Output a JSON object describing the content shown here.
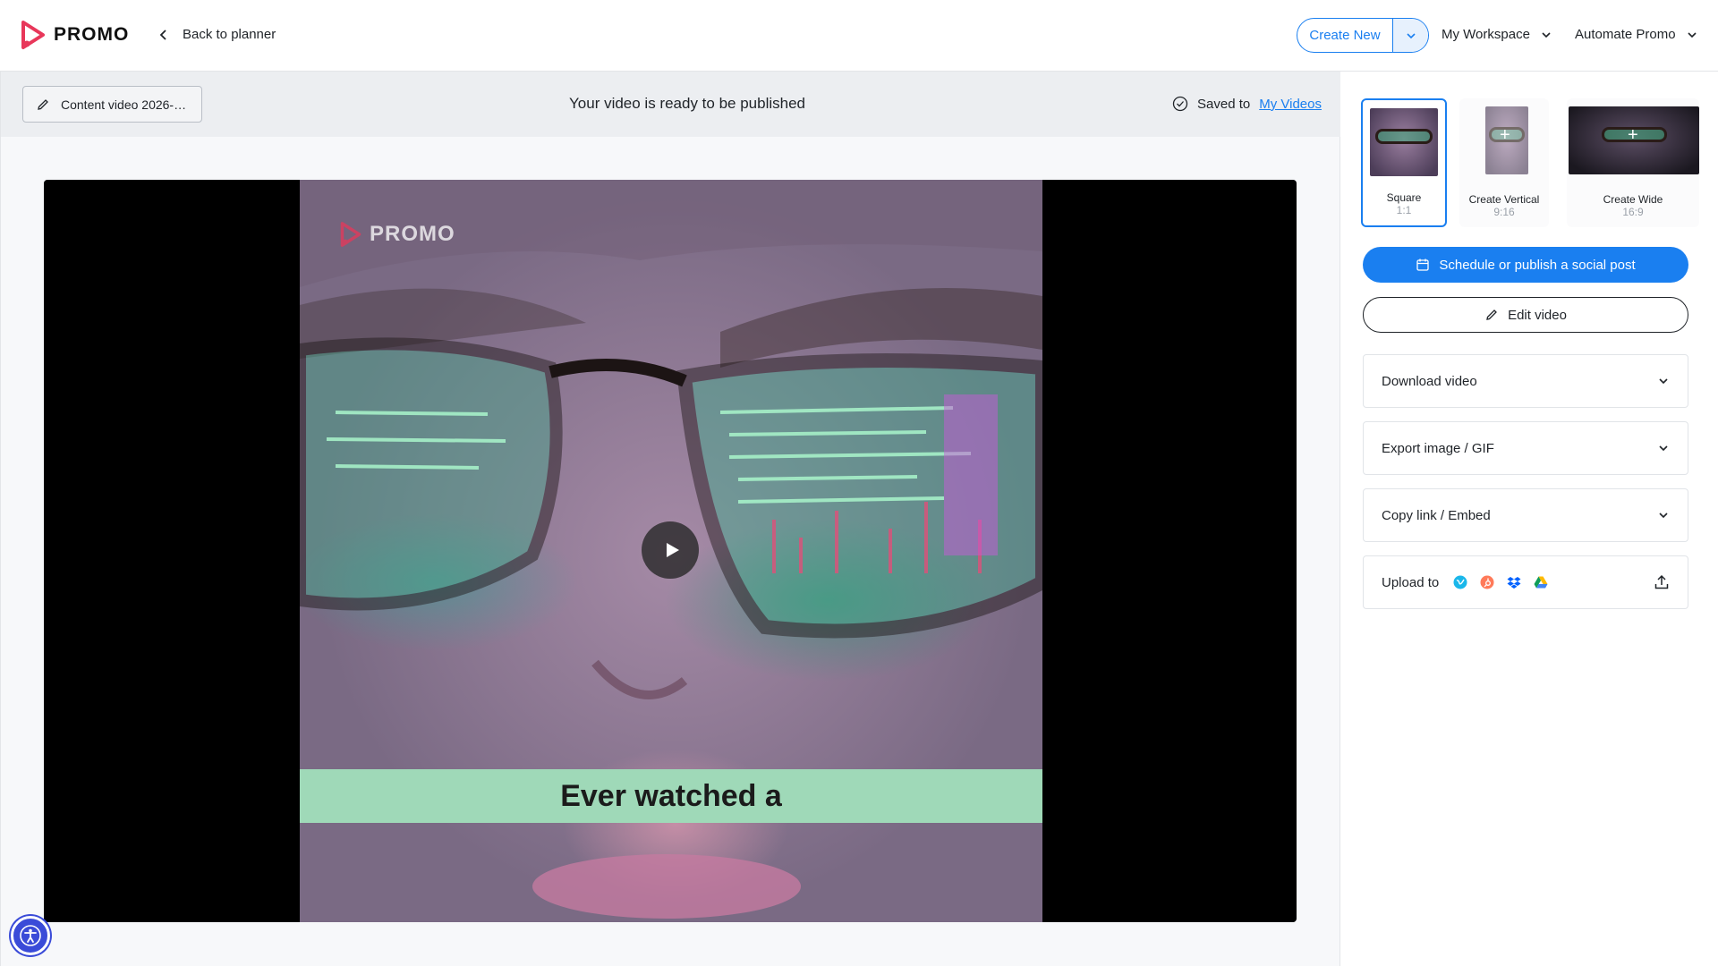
{
  "header": {
    "logo_text": "PROMO",
    "back_label": "Back to planner",
    "create_new_label": "Create New",
    "workspace_label": "My Workspace",
    "automate_label": "Automate Promo"
  },
  "infobar": {
    "video_title": "Content video 2026-…",
    "ready_text": "Your video is ready to be published",
    "saved_prefix": "Saved to",
    "saved_link": "My Videos"
  },
  "player": {
    "watermark": "PROMO",
    "caption": "Ever watched a"
  },
  "formats": [
    {
      "name": "Square",
      "ratio": "1:1",
      "selected": true
    },
    {
      "name": "Create Vertical",
      "ratio": "9:16",
      "selected": false
    },
    {
      "name": "Create Wide",
      "ratio": "16:9",
      "selected": false
    }
  ],
  "actions": {
    "schedule_label": "Schedule or publish a social post",
    "edit_label": "Edit video"
  },
  "accordions": {
    "download": "Download video",
    "export": "Export image / GIF",
    "copy": "Copy link / Embed",
    "upload": "Upload to"
  },
  "colors": {
    "accent": "#1a7ff0",
    "brand": "#e8375a",
    "caption_band": "#9fd9b8"
  }
}
